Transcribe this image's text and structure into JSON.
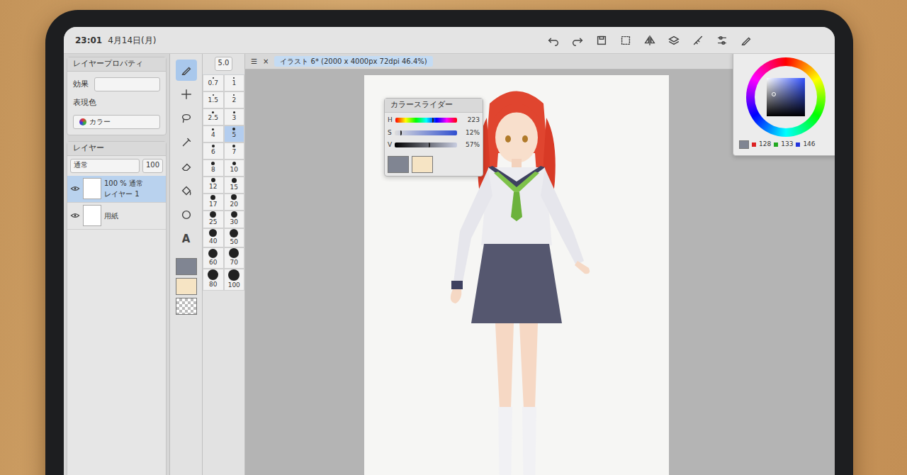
{
  "status_bar": {
    "time": "23:01",
    "date": "4月14日(月)"
  },
  "document_tab": {
    "menu_glyph": "☰",
    "close_glyph": "×",
    "title": "イラスト 6* (2000 x 4000px 72dpi 46.4%)"
  },
  "layer_property": {
    "title": "レイヤープロパティ",
    "effect_label": "効果",
    "color_label": "表現色",
    "color_value": "カラー"
  },
  "layers_panel": {
    "title": "レイヤー",
    "blend": "通常",
    "opacity": "100",
    "layers": [
      {
        "info": "100 % 通常",
        "name": "レイヤー 1",
        "selected": true,
        "visible": true
      },
      {
        "info": "",
        "name": "用紙",
        "selected": false,
        "visible": true
      }
    ]
  },
  "tools": [
    {
      "glyph": "",
      "selected": true
    },
    {
      "glyph": "",
      "selected": false
    },
    {
      "glyph": "",
      "selected": false
    },
    {
      "glyph": "",
      "selected": false
    },
    {
      "glyph": "",
      "selected": false
    },
    {
      "glyph": "",
      "selected": false
    },
    {
      "glyph": "",
      "selected": false
    },
    {
      "glyph": "A",
      "selected": false
    }
  ],
  "current_colors": {
    "main": "#808592",
    "sub": "#f6e4c4"
  },
  "color_slider": {
    "title": "カラースライダー",
    "rows": [
      {
        "label": "H",
        "value": "223",
        "level": 0.62
      },
      {
        "label": "S",
        "value": "12%",
        "level": 0.12
      },
      {
        "label": "V",
        "value": "57%",
        "level": 0.57
      }
    ]
  },
  "brush_size": {
    "value": "5.0",
    "sizes": [
      {
        "label": "0.7",
        "selected": false
      },
      {
        "label": "1",
        "selected": false
      },
      {
        "label": "1.5",
        "selected": false
      },
      {
        "label": "2",
        "selected": false
      },
      {
        "label": "2.5",
        "selected": false
      },
      {
        "label": "3",
        "selected": false
      },
      {
        "label": "4",
        "selected": false
      },
      {
        "label": "5",
        "selected": true
      },
      {
        "label": "6",
        "selected": false
      },
      {
        "label": "7",
        "selected": false
      },
      {
        "label": "8",
        "selected": false
      },
      {
        "label": "10",
        "selected": false
      },
      {
        "label": "12",
        "selected": false
      },
      {
        "label": "15",
        "selected": false
      },
      {
        "label": "17",
        "selected": false
      },
      {
        "label": "20",
        "selected": false
      },
      {
        "label": "25",
        "selected": false
      },
      {
        "label": "30",
        "selected": false
      },
      {
        "label": "40",
        "selected": false
      },
      {
        "label": "50",
        "selected": false
      },
      {
        "label": "60",
        "selected": false
      },
      {
        "label": "70",
        "selected": false
      },
      {
        "label": "80",
        "selected": false
      },
      {
        "label": "100",
        "selected": false
      }
    ]
  },
  "color_wheel": {
    "r": "128",
    "g": "133",
    "b": "146",
    "color": "#808592"
  }
}
